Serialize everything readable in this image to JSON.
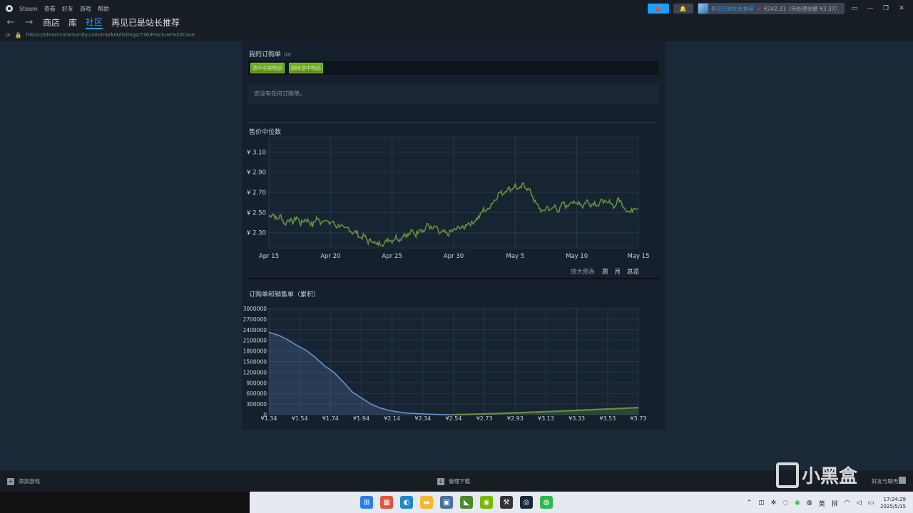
{
  "app": {
    "menu": [
      "Steam",
      "查看",
      "好友",
      "游戏",
      "帮助"
    ],
    "nav": [
      "商店",
      "库",
      "社区",
      "再见已是站长推荐"
    ],
    "active_nav": "社区",
    "url": "https://steamcommunity.com/market/listings/730/Fracture%20Case"
  },
  "account": {
    "user_name": "再见已是站长推荐",
    "wallet": "¥242.31（待处理余额 ¥3.37）"
  },
  "orders": {
    "title": "我的订购单",
    "count": "(0)",
    "select_all_label": "选中全部物品",
    "remove_selected_label": "删除选中物品",
    "empty_text": "您没有任何订购单。"
  },
  "zoom": {
    "label": "放大图表",
    "options": [
      "周",
      "月",
      "总览"
    ]
  },
  "chart_data": [
    {
      "type": "line",
      "title": "售价中位数",
      "x_ticks": [
        "Apr 15",
        "Apr 20",
        "Apr 25",
        "Apr 30",
        "May 5",
        "May 10",
        "May 15"
      ],
      "y_ticks": [
        "¥ 2.30",
        "¥ 2.50",
        "¥ 2.70",
        "¥ 2.90",
        "¥ 3.10"
      ],
      "ylim": [
        2.15,
        3.25
      ],
      "grid": true,
      "color": "#688f3e",
      "x": [
        0,
        0.5,
        1,
        1.5,
        2,
        2.5,
        3,
        3.5,
        4,
        4.5,
        5,
        5.5,
        6,
        6.5,
        7,
        7.5,
        8,
        8.5,
        9,
        9.5,
        10,
        10.5,
        11,
        11.5,
        12,
        12.5,
        13,
        13.5,
        14,
        14.5,
        15,
        15.5,
        16,
        16.5,
        17,
        17.5,
        18,
        18.5,
        19,
        19.5,
        20,
        20.5,
        21,
        21.5,
        22,
        22.5,
        23,
        23.5,
        24,
        24.5,
        25,
        25.5,
        26,
        26.5,
        27,
        27.5,
        28,
        28.5,
        29,
        29.5,
        30
      ],
      "y": [
        2.46,
        2.49,
        2.43,
        2.47,
        2.38,
        2.44,
        2.4,
        2.46,
        2.39,
        2.43,
        2.42,
        2.37,
        2.45,
        2.4,
        2.44,
        2.39,
        2.41,
        2.36,
        2.38,
        2.33,
        2.35,
        2.3,
        2.31,
        2.25,
        2.27,
        2.21,
        2.23,
        2.18,
        2.2,
        2.19,
        2.24,
        2.22,
        2.26,
        2.23,
        2.29,
        2.27,
        2.32,
        2.28,
        2.35,
        2.31,
        2.39,
        2.33,
        2.36,
        2.29,
        2.31,
        2.28,
        2.32,
        2.33,
        2.36,
        2.34,
        2.4,
        2.39,
        2.43,
        2.46,
        2.53,
        2.52,
        2.59,
        2.63,
        2.7,
        2.69,
        2.74,
        2.73,
        2.77,
        2.72,
        2.78,
        2.74,
        2.7,
        2.6,
        2.55,
        2.5,
        2.56,
        2.52,
        2.57,
        2.51,
        2.6,
        2.55,
        2.62,
        2.58,
        2.61,
        2.56,
        2.62,
        2.58,
        2.6,
        2.57,
        2.63,
        2.58,
        2.61,
        2.55,
        2.64,
        2.58,
        2.53,
        2.5,
        2.56,
        2.54
      ]
    },
    {
      "type": "area",
      "title": "订购单和销售单（累积）",
      "x_ticks": [
        "¥1.34",
        "¥1.54",
        "¥1.74",
        "¥1.94",
        "¥2.14",
        "¥2.34",
        "¥2.54",
        "¥2.73",
        "¥2.93",
        "¥3.13",
        "¥3.33",
        "¥3.53",
        "¥3.73"
      ],
      "y_ticks": [
        "0",
        "300000",
        "600000",
        "900000",
        "1200000",
        "1500000",
        "1800000",
        "2100000",
        "2400000",
        "2700000",
        "3000000"
      ],
      "xlim": [
        1.34,
        3.73
      ],
      "ylim": [
        0,
        3000000
      ],
      "grid": true,
      "series": [
        {
          "name": "",
          "color": "#6b8fc9",
          "x": [
            1.34,
            1.4,
            1.46,
            1.52,
            1.58,
            1.64,
            1.7,
            1.76,
            1.82,
            1.88,
            1.94,
            2.0,
            2.06,
            2.12,
            2.18,
            2.24,
            2.3,
            2.36,
            2.42,
            2.48,
            2.54
          ],
          "y": [
            2330000,
            2250000,
            2120000,
            1960000,
            1820000,
            1620000,
            1380000,
            1200000,
            930000,
            640000,
            470000,
            300000,
            190000,
            120000,
            75000,
            45000,
            28000,
            17000,
            9000,
            3000,
            0
          ]
        },
        {
          "name": "",
          "color": "#688f3e",
          "x": [
            2.54,
            2.73,
            2.93,
            3.13,
            3.33,
            3.53,
            3.73
          ],
          "y": [
            0,
            20000,
            50000,
            85000,
            120000,
            160000,
            200000
          ]
        }
      ]
    }
  ],
  "bottom_bar": {
    "add_game": "添加游戏",
    "manage_downloads": "管理下载",
    "friends_chat": "好友与聊天"
  },
  "taskbar": {
    "ime_lang": "英",
    "ime_mode": "拼",
    "time": "17:24:29",
    "date": "2025/5/15"
  },
  "watermark": {
    "text": "小黑盒"
  }
}
